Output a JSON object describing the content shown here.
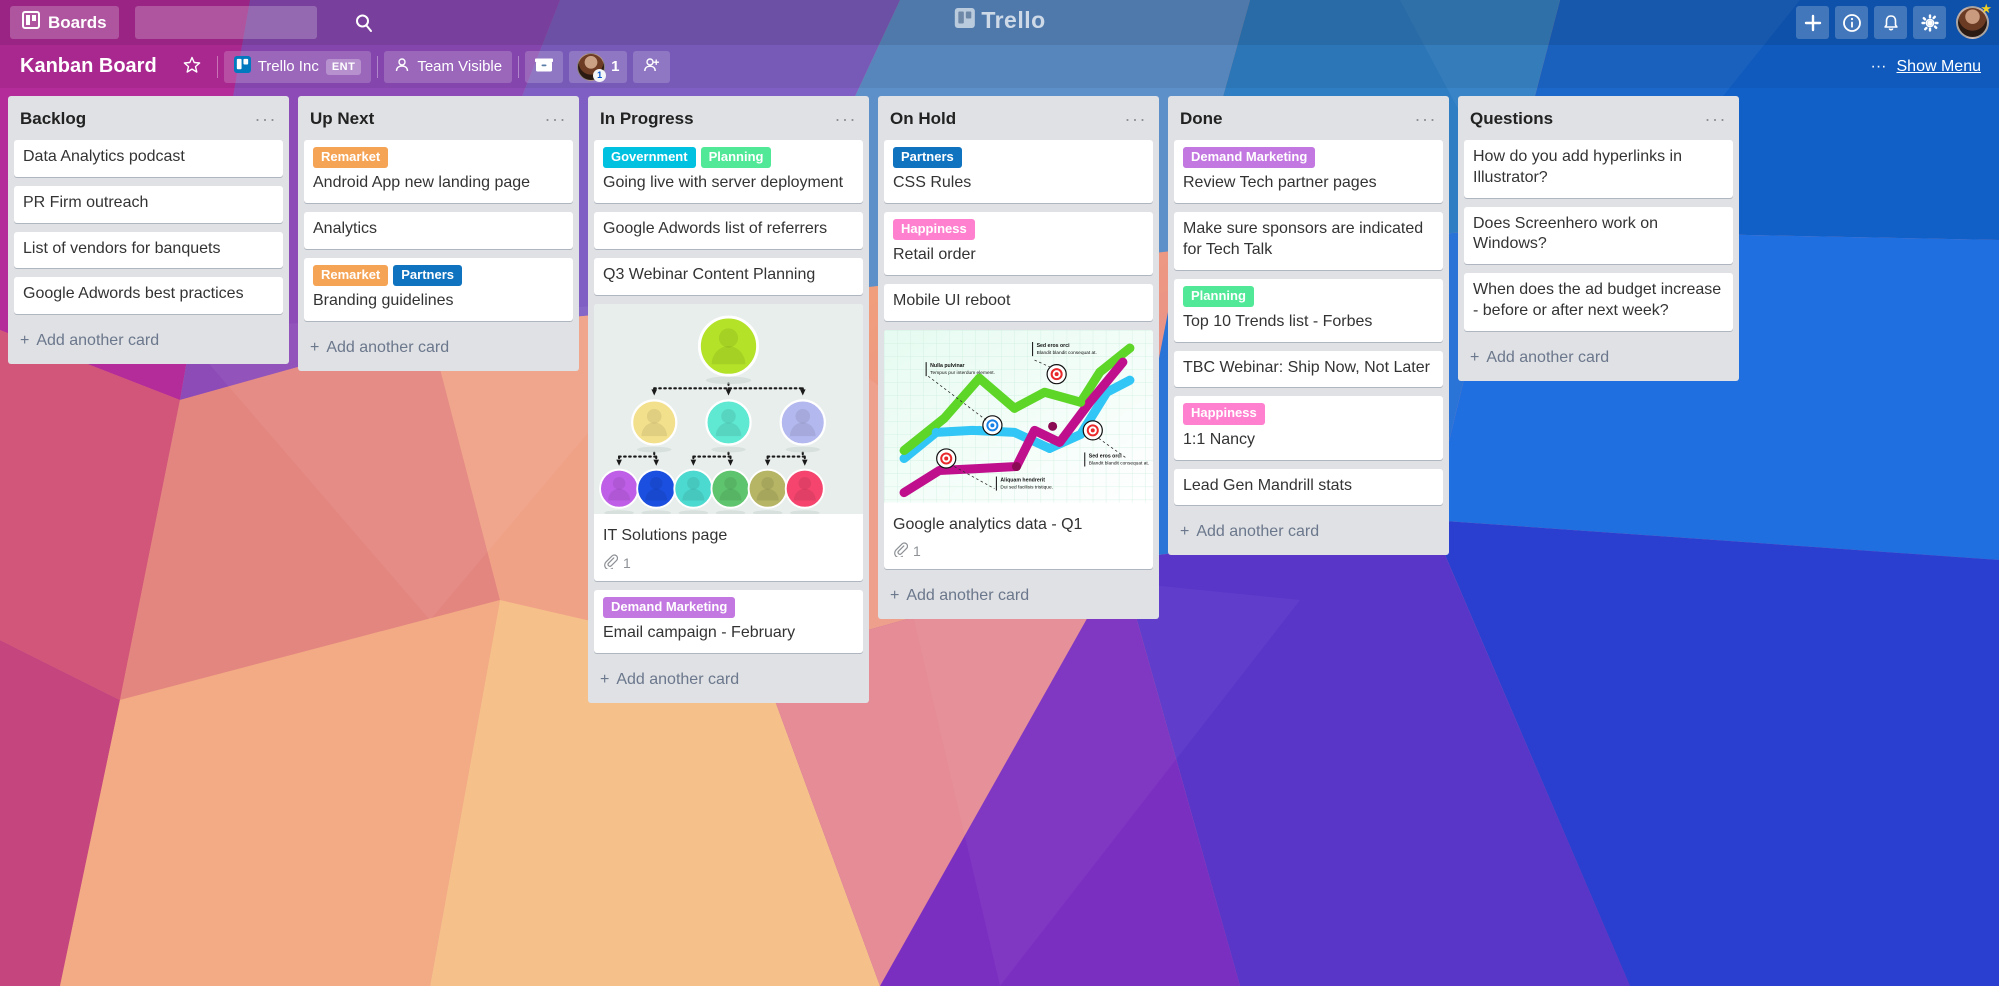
{
  "nav": {
    "boards_label": "Boards",
    "boards_icon": "board-grid-icon",
    "search_placeholder": "",
    "search_value": "",
    "search_icon": "search-icon",
    "logo_text": "Trello",
    "add_icon": "plus-icon",
    "info_icon": "info-circle-icon",
    "notifications_icon": "bell-icon",
    "settings_icon": "gear-icon",
    "avatar_name": "user-avatar"
  },
  "boardbar": {
    "title": "Kanban Board",
    "star_icon": "star-icon",
    "team_name": "Trello Inc",
    "team_plan": "ENT",
    "team_icon": "board-grid-icon",
    "visibility": "Team Visible",
    "visibility_icon": "person-icon",
    "archive_icon": "archive-box-icon",
    "member_count": "1",
    "member_badge": "1",
    "add_member_icon": "add-person-icon",
    "menu_dots": "···",
    "show_menu": "Show Menu"
  },
  "add_card_label": "Add another card",
  "labels": {
    "remarket": {
      "text": "Remarket",
      "color": "#f5a355"
    },
    "partners": {
      "text": "Partners",
      "color": "#1073bf"
    },
    "government": {
      "text": "Government",
      "color": "#00c2e0"
    },
    "planning": {
      "text": "Planning",
      "color": "#51e898"
    },
    "demand_marketing": {
      "text": "Demand Marketing",
      "color": "#c377e0"
    },
    "happiness": {
      "text": "Happiness",
      "color": "#ff80ce"
    }
  },
  "lists": [
    {
      "title": "Backlog",
      "cards": [
        {
          "title": "Data Analytics podcast",
          "labels": []
        },
        {
          "title": "PR Firm outreach",
          "labels": []
        },
        {
          "title": "List of vendors for banquets",
          "labels": []
        },
        {
          "title": "Google Adwords best practices",
          "labels": []
        }
      ]
    },
    {
      "title": "Up Next",
      "cards": [
        {
          "title": "Android App new landing page",
          "labels": [
            {
              "text": "Remarket",
              "color": "#f5a355"
            }
          ]
        },
        {
          "title": "Analytics",
          "labels": []
        },
        {
          "title": "Branding guidelines",
          "labels": [
            {
              "text": "Remarket",
              "color": "#f5a355"
            },
            {
              "text": "Partners",
              "color": "#1073bf"
            }
          ]
        }
      ]
    },
    {
      "title": "In Progress",
      "cards": [
        {
          "title": "Going live with server deployment",
          "labels": [
            {
              "text": "Government",
              "color": "#00c2e0"
            },
            {
              "text": "Planning",
              "color": "#51e898"
            }
          ]
        },
        {
          "title": "Google Adwords list of referrers",
          "labels": []
        },
        {
          "title": "Q3 Webinar Content Planning",
          "labels": []
        },
        {
          "title": "IT Solutions page",
          "labels": [],
          "cover": "org-chart",
          "attachments": "1"
        },
        {
          "title": "Email campaign - February",
          "labels": [
            {
              "text": "Demand Marketing",
              "color": "#c377e0"
            }
          ]
        }
      ]
    },
    {
      "title": "On Hold",
      "cards": [
        {
          "title": "CSS Rules",
          "labels": [
            {
              "text": "Partners",
              "color": "#1073bf"
            }
          ]
        },
        {
          "title": "Retail order",
          "labels": [
            {
              "text": "Happiness",
              "color": "#ff80ce"
            }
          ]
        },
        {
          "title": "Mobile UI reboot",
          "labels": []
        },
        {
          "title": "Google analytics data - Q1",
          "labels": [],
          "cover": "line-chart",
          "attachments": "1"
        }
      ]
    },
    {
      "title": "Done",
      "cards": [
        {
          "title": "Review Tech partner pages",
          "labels": [
            {
              "text": "Demand Marketing",
              "color": "#c377e0"
            }
          ]
        },
        {
          "title": "Make sure sponsors are indicated for Tech Talk",
          "labels": []
        },
        {
          "title": "Top 10 Trends list - Forbes",
          "labels": [
            {
              "text": "Planning",
              "color": "#51e898"
            }
          ]
        },
        {
          "title": "TBC Webinar: Ship Now, Not Later",
          "labels": []
        },
        {
          "title": "1:1 Nancy",
          "labels": [
            {
              "text": "Happiness",
              "color": "#ff80ce"
            }
          ]
        },
        {
          "title": "Lead Gen Mandrill stats",
          "labels": []
        }
      ]
    },
    {
      "title": "Questions",
      "cards": [
        {
          "title": "How do you add hyperlinks in Illustrator?",
          "labels": []
        },
        {
          "title": "Does Screenhero work on Windows?",
          "labels": []
        },
        {
          "title": "When does the ad budget increase - before or after next week?",
          "labels": []
        }
      ]
    }
  ],
  "covers": {
    "org_chart": {
      "background": "#e8eeec",
      "root": "#b4e228",
      "level2": [
        "#f3e08c",
        "#5fe8d2",
        "#b3b8ee"
      ],
      "level3": [
        "#bf5fe8",
        "#1a4fe0",
        "#4cd9cf",
        "#5fc46e",
        "#b6b565",
        "#f5456e"
      ]
    },
    "line_chart": {
      "background": "#eefaf4",
      "series_colors": [
        "#5ed628",
        "#31c6f5",
        "#bf0f8c"
      ],
      "marker_colors": [
        "#e8282a",
        "#1781e8",
        "#e8282a"
      ],
      "annotations": [
        "Nulla pulvinar\nTempus pur interdum element.",
        "Sed eros orci\nBlandit blandit consequat at.",
        "Sed eros orci\nBlandit blandit consequat at.",
        "Aliquam hendrerit\nDui sed facilisis tristique."
      ]
    }
  }
}
